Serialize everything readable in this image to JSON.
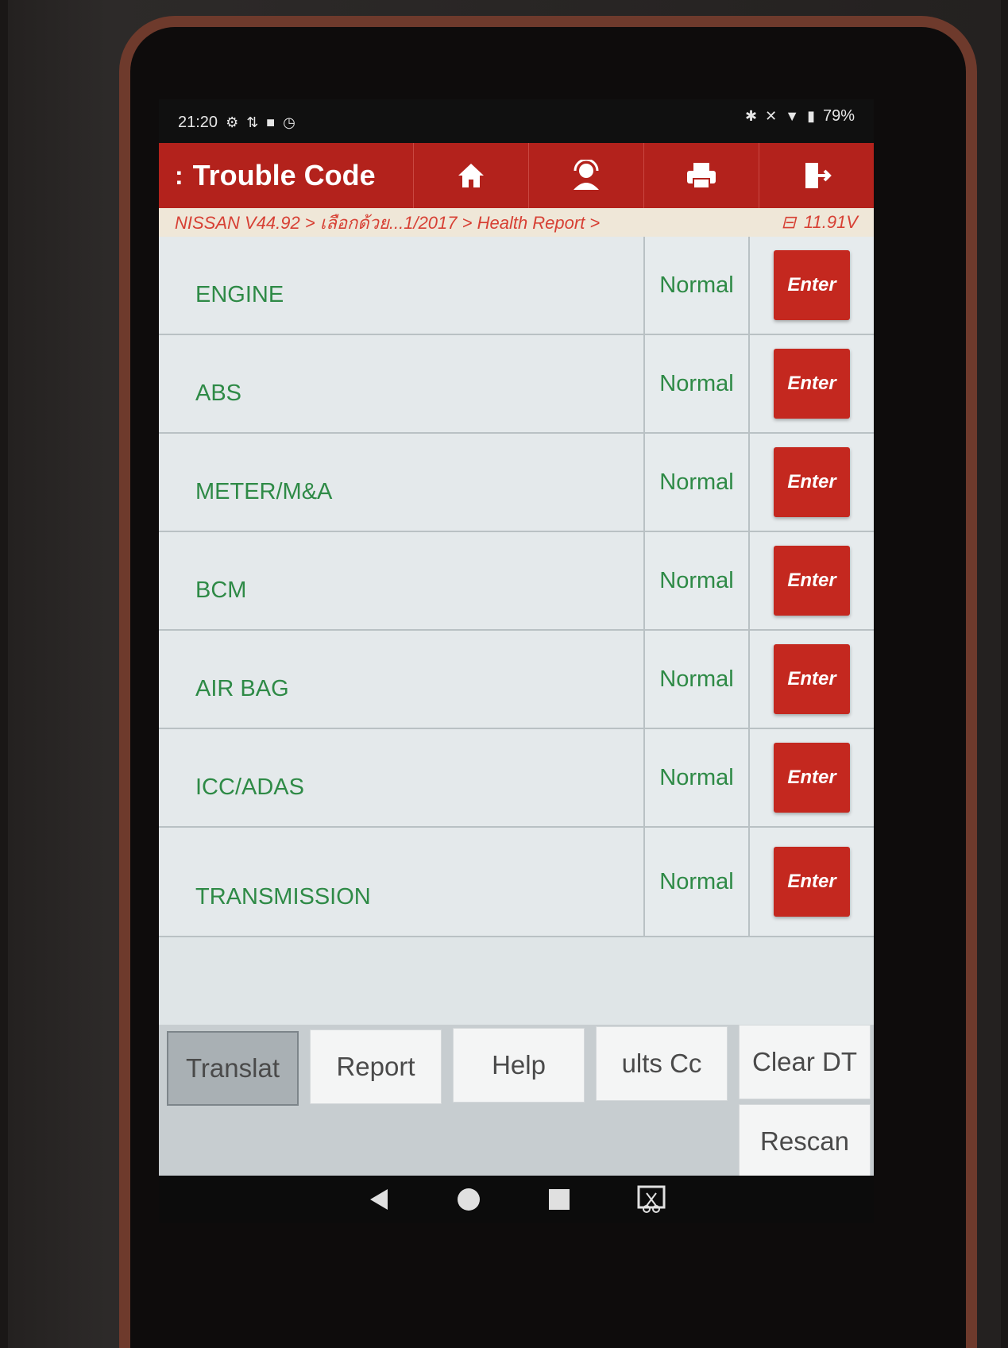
{
  "status_bar": {
    "time": "21:20",
    "battery_percent": "79%"
  },
  "header": {
    "title": "Trouble Code",
    "toolbar": [
      {
        "icon": "home-icon"
      },
      {
        "icon": "support-icon"
      },
      {
        "icon": "print-icon"
      },
      {
        "icon": "exit-icon"
      }
    ]
  },
  "breadcrumb": {
    "path": "NISSAN V44.92 > เลือกด้วย...1/2017 > Health Report >",
    "voltage": "11.91V"
  },
  "systems": [
    {
      "name": "ENGINE",
      "status": "Normal",
      "action": "Enter"
    },
    {
      "name": "ABS",
      "status": "Normal",
      "action": "Enter"
    },
    {
      "name": "METER/M&A",
      "status": "Normal",
      "action": "Enter"
    },
    {
      "name": "BCM",
      "status": "Normal",
      "action": "Enter"
    },
    {
      "name": "AIR BAG",
      "status": "Normal",
      "action": "Enter"
    },
    {
      "name": "ICC/ADAS",
      "status": "Normal",
      "action": "Enter"
    },
    {
      "name": "TRANSMISSION",
      "status": "Normal",
      "action": "Enter"
    }
  ],
  "actions": {
    "translate": "Translat",
    "report": "Report",
    "help": "Help",
    "results": "ults     Cc",
    "clear_dtc": "Clear DT",
    "rescan": "Rescan"
  },
  "colors": {
    "header_red": "#b3221c",
    "enter_red": "#c4281f",
    "status_green": "#2e8a46",
    "breadcrumb_red": "#d74034"
  }
}
